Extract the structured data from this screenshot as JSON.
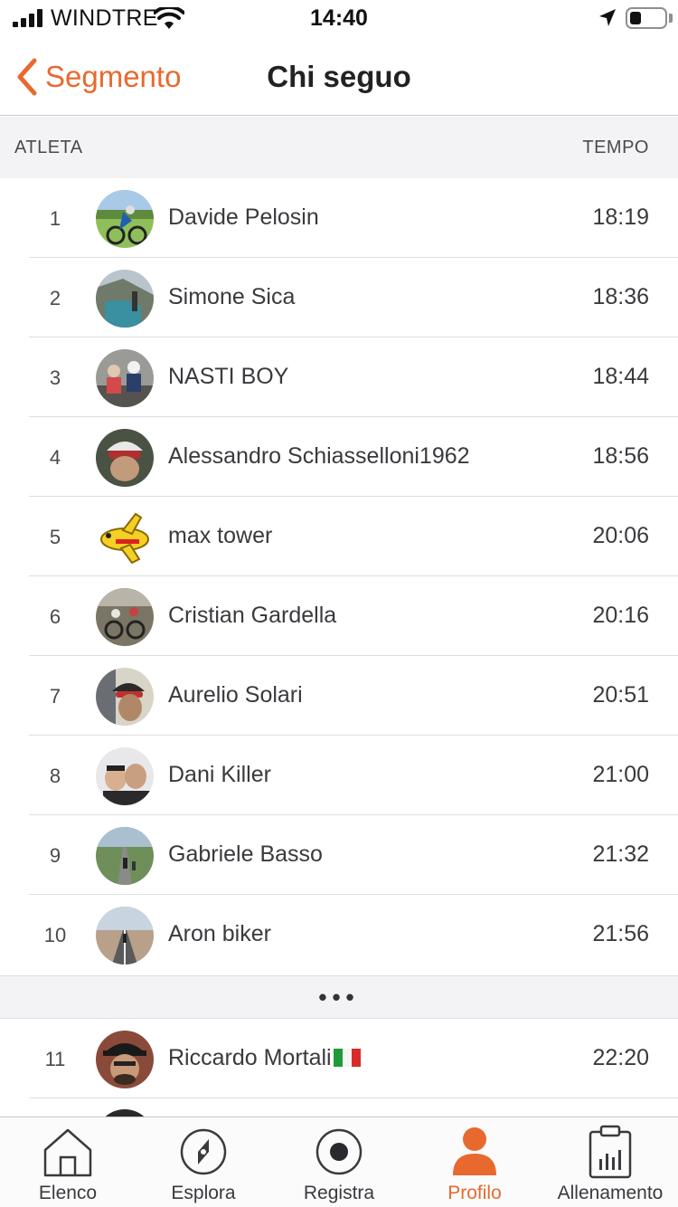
{
  "status_bar": {
    "carrier": "WINDTRE",
    "time": "14:40"
  },
  "header": {
    "back_label": "Segmento",
    "title": "Chi seguo"
  },
  "columns": {
    "athlete": "ATLETA",
    "time": "TEMPO"
  },
  "leaderboard": [
    {
      "rank": "1",
      "name": "Davide Pelosin",
      "time": "18:19",
      "avatar": "cyclist-photo"
    },
    {
      "rank": "2",
      "name": "Simone Sica",
      "time": "18:36",
      "avatar": "lake-cyclist-photo"
    },
    {
      "rank": "3",
      "name": "NASTI BOY",
      "time": "18:44",
      "avatar": "group-cyclists-photo"
    },
    {
      "rank": "4",
      "name": "Alessandro Schiasselloni1962",
      "time": "18:56",
      "avatar": "helmet-selfie-photo"
    },
    {
      "rank": "5",
      "name": "max tower",
      "time": "20:06",
      "avatar": "cartoon-airplane"
    },
    {
      "rank": "6",
      "name": "Cristian Gardella",
      "time": "20:16",
      "avatar": "bikes-rest-photo"
    },
    {
      "rank": "7",
      "name": "Aurelio Solari",
      "time": "20:51",
      "avatar": "helmet-portrait-photo"
    },
    {
      "rank": "8",
      "name": "Dani Killer",
      "time": "21:00",
      "avatar": "couple-selfie-photo"
    },
    {
      "rank": "9",
      "name": "Gabriele Basso",
      "time": "21:32",
      "avatar": "road-cyclists-photo"
    },
    {
      "rank": "10",
      "name": "Aron biker",
      "time": "21:56",
      "avatar": "road-photo"
    }
  ],
  "gap_indicator": "•••",
  "leaderboard_after_gap": [
    {
      "rank": "11",
      "name": "Riccardo Mortali",
      "time": "22:20",
      "avatar": "cap-selfie-photo",
      "flag": "italy-flag"
    }
  ],
  "tabs": [
    {
      "label": "Elenco",
      "icon": "home-icon",
      "active": false
    },
    {
      "label": "Esplora",
      "icon": "compass-icon",
      "active": false
    },
    {
      "label": "Registra",
      "icon": "record-icon",
      "active": false
    },
    {
      "label": "Profilo",
      "icon": "profile-icon",
      "active": true
    },
    {
      "label": "Allenamento",
      "icon": "clipboard-chart-icon",
      "active": false
    }
  ],
  "colors": {
    "accent": "#e8692e",
    "header_bg": "#f3f3f5",
    "divider": "#dedee2"
  }
}
